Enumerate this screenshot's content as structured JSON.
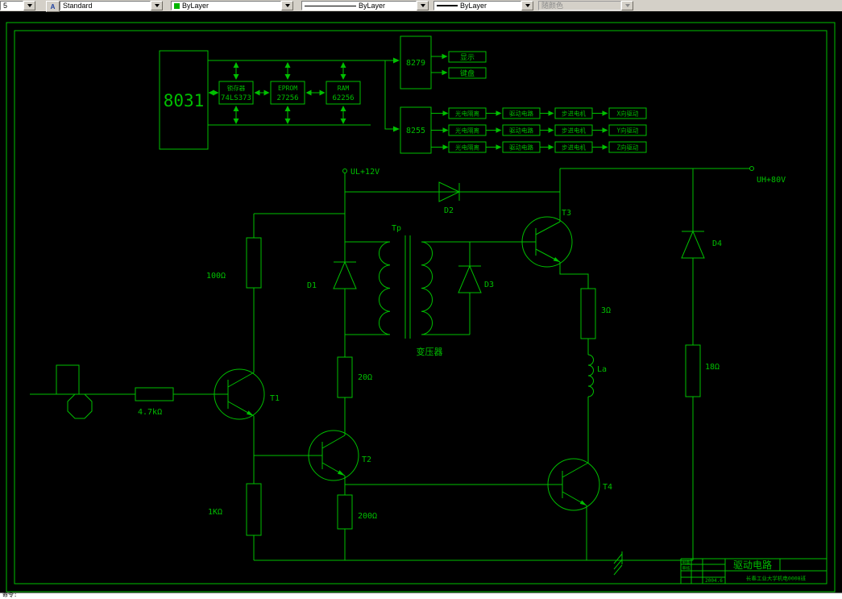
{
  "toolbar": {
    "left_combo": "5",
    "style_icon_glyph": "A",
    "style": "Standard",
    "color": "ByLayer",
    "linetype": "ByLayer",
    "lineweight": "ByLayer",
    "plot_style": "随颜色",
    "accent_swatch": "#00b400"
  },
  "command_line": {
    "prompt": "命令:"
  },
  "diagram": {
    "mcu": "8031",
    "latch": [
      "锁存器",
      "74LS373"
    ],
    "eprom": [
      "EPROM",
      "27256"
    ],
    "ram": [
      "RAM",
      "62256"
    ],
    "kbd_display_ctrl": "8279",
    "display": "显示",
    "keyboard": "键盘",
    "pio": "8255",
    "rows": [
      [
        "光电隔离",
        "驱动电路",
        "步进电机",
        "X向驱动"
      ],
      [
        "光电隔离",
        "驱动电路",
        "步进电机",
        "Y向驱动"
      ],
      [
        "光电隔离",
        "驱动电路",
        "步进电机",
        "Z向驱动"
      ]
    ],
    "labels": {
      "ul": "UL+12V",
      "uh": "UH+80V",
      "d1": "D1",
      "d2": "D2",
      "d3": "D3",
      "d4": "D4",
      "t1": "T1",
      "t2": "T2",
      "t3": "T3",
      "t4": "T4",
      "tp": "Tp",
      "transformer": "变压器",
      "la": "La",
      "r100": "100Ω",
      "r4k7": "4.7kΩ",
      "r1k": "1KΩ",
      "r20": "20Ω",
      "r200": "200Ω",
      "r3": "3Ω",
      "r18": "18Ω"
    },
    "title_block": {
      "title": "驱动电路",
      "cell_a": "制图",
      "cell_b": "审核",
      "date": "2004.6",
      "org": "长春工业大学机电0008班"
    }
  }
}
